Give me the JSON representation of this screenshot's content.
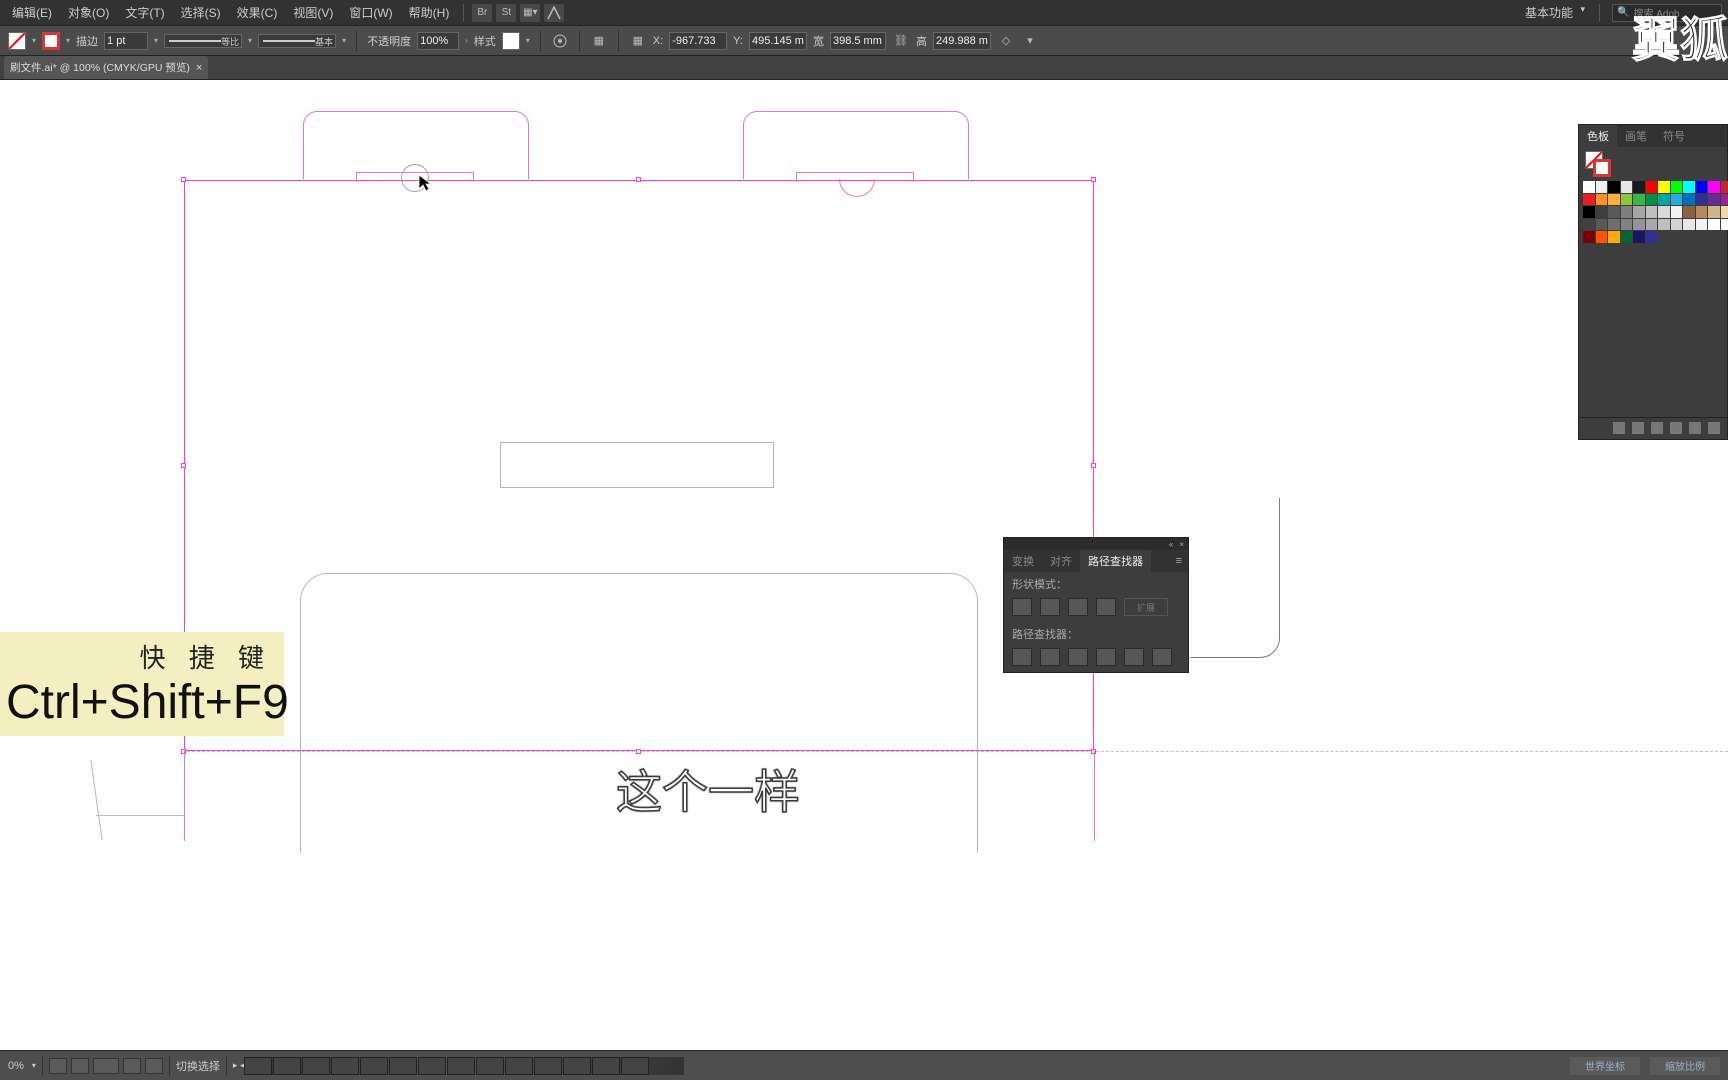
{
  "menubar": {
    "items": [
      "编辑(E)",
      "对象(O)",
      "文字(T)",
      "选择(S)",
      "效果(C)",
      "视图(V)",
      "窗口(W)",
      "帮助(H)"
    ],
    "workspace": "基本功能",
    "search_placeholder": "搜索 Adob"
  },
  "controlbar": {
    "stroke_label": "描边",
    "stroke_width": "1 pt",
    "dash_label": "等比",
    "profile_label": "基本",
    "opacity_label": "不透明度",
    "opacity_value": "100%",
    "style_label": "样式",
    "x_label": "X:",
    "x_value": "-967.733",
    "y_label": "Y:",
    "y_value": "495.145 m",
    "w_label": "宽",
    "w_value": "398.5 mm",
    "h_label": "高",
    "h_value": "249.988 m"
  },
  "tab": {
    "title": "刷文件.ai* @ 100% (CMYK/GPU 预览)"
  },
  "swatches": {
    "tabs": [
      "色板",
      "画笔",
      "符号"
    ],
    "colors": [
      [
        "#ffffff",
        "#f0f0f0",
        "#000000",
        "#e6e6e6",
        "#1a1a1a",
        "#ff0000",
        "#ffff00",
        "#00ff00",
        "#00ffff",
        "#0000ff",
        "#ff00ff",
        "#c1272d"
      ],
      [
        "#ed1c24",
        "#f7931e",
        "#fbb03b",
        "#8cc63f",
        "#39b54a",
        "#009245",
        "#00a99d",
        "#29abe2",
        "#0071bc",
        "#2e3192",
        "#662d91",
        "#93278f"
      ],
      [
        "#000000",
        "#3f3f3f",
        "#595959",
        "#7f7f7f",
        "#a6a6a6",
        "#bfbfbf",
        "#d9d9d9",
        "#f2f2f2",
        "#8b6239",
        "#b58b5a",
        "#d2b48c",
        "#edd9b5"
      ],
      [
        "#414042",
        "#58595b",
        "#6d6e71",
        "#808285",
        "#939598",
        "#a7a9ac",
        "#bcbec0",
        "#d1d3d4",
        "#e6e7e8",
        "#f1f2f2",
        "#ffffff",
        "#ffffff"
      ],
      [
        "#7b0000",
        "#ff5500",
        "#ffaa00",
        "#006837",
        "#1b1464",
        "#2e3192",
        "",
        "",
        "",
        "",
        "",
        ""
      ]
    ]
  },
  "pathfinder": {
    "tabs": [
      "变换",
      "对齐",
      "路径查找器"
    ],
    "shape_modes_label": "形状模式：",
    "pathfinders_label": "路径查找器：",
    "expand_label": "扩展"
  },
  "statusbar": {
    "zoom": "0%",
    "tool": "切换选择",
    "right_btn1": "世界坐标",
    "right_btn2": "缩放比例"
  },
  "overlay": {
    "shortcut_title": "快 捷 键",
    "shortcut_keys": "Ctrl+Shift+F9",
    "subtitle": "这个一样"
  },
  "watermark": "翼狐"
}
